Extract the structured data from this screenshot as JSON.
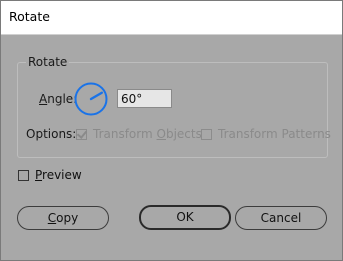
{
  "window": {
    "title": "Rotate"
  },
  "rotate_group": {
    "label": "Rotate",
    "angle_label_prefix": "A",
    "angle_label_rest": "ngle:",
    "angle_value": "60°",
    "options_label": "Options:",
    "transform_objects": {
      "label_pre": "Transform ",
      "label_u": "O",
      "label_post": "bjects",
      "checked": true,
      "enabled": false
    },
    "transform_patterns": {
      "label": "Transform Patterns",
      "checked": false,
      "enabled": false
    }
  },
  "preview": {
    "label_u": "P",
    "label_rest": "review",
    "checked": false
  },
  "buttons": {
    "copy_u": "C",
    "copy_rest": "opy",
    "ok": "OK",
    "cancel": "Cancel"
  },
  "colors": {
    "dial_accent": "#1a73e8",
    "dialog_bg": "#a8a8a8"
  },
  "angle_degrees": 60
}
